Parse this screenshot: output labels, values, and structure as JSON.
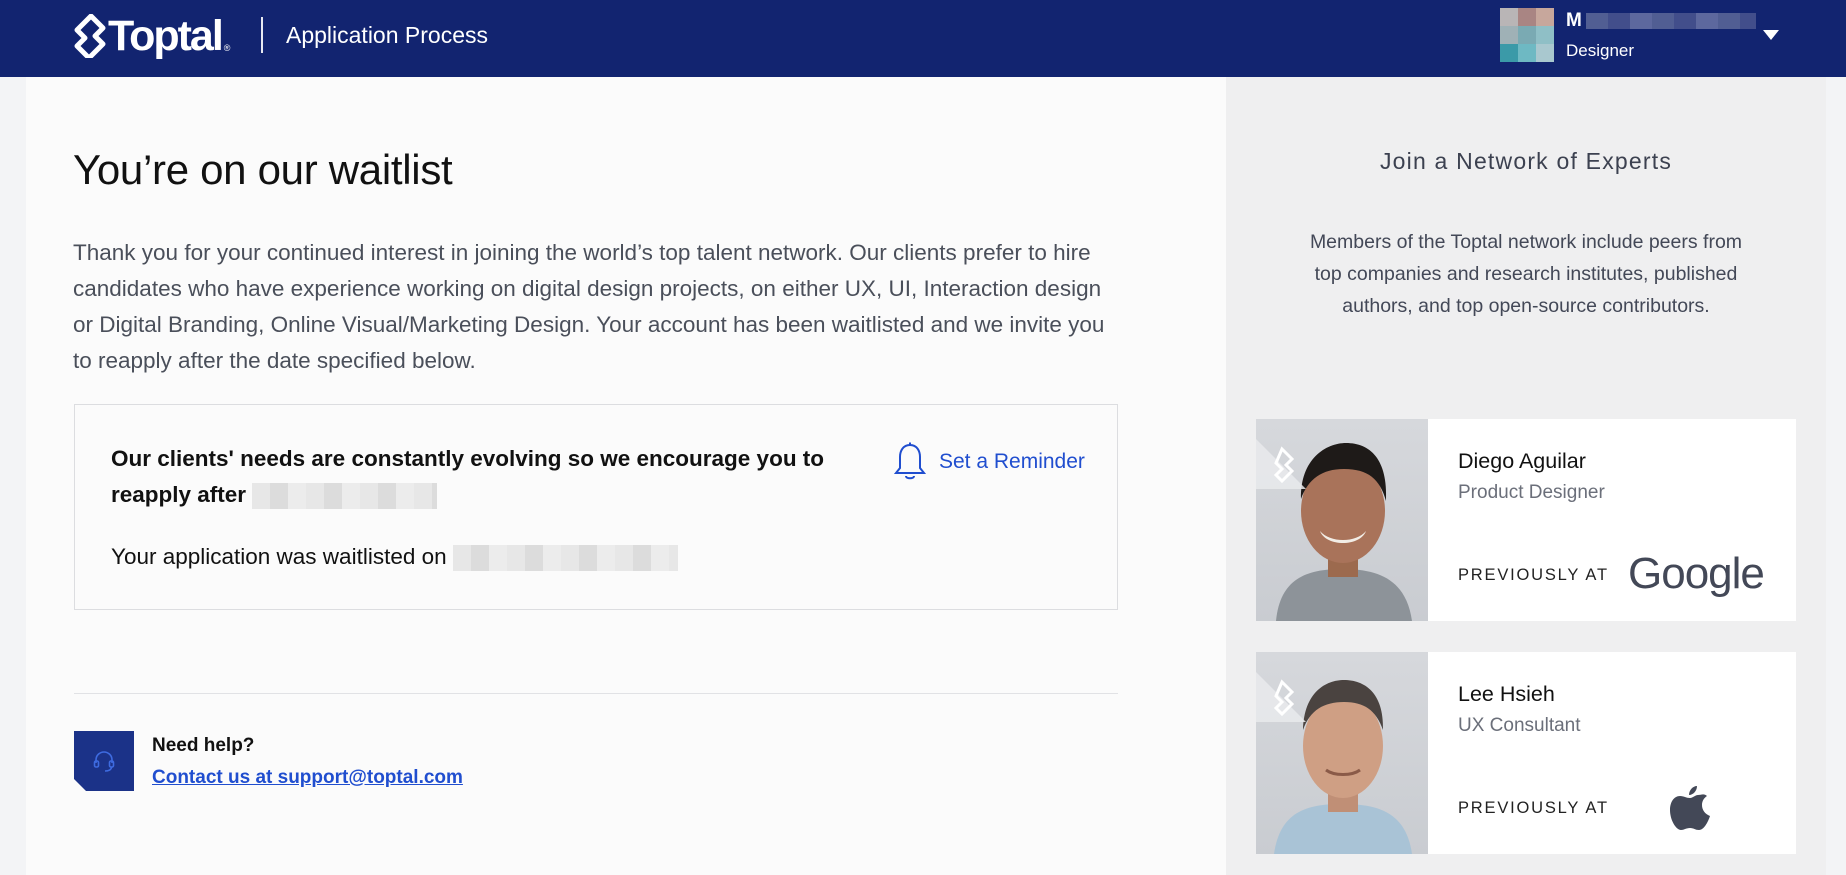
{
  "header": {
    "logo_text": "Toptal",
    "logo_reg": "®",
    "app_title": "Application Process",
    "user": {
      "name_initial": "M",
      "role": "Designer"
    }
  },
  "main": {
    "title": "You’re on our waitlist",
    "intro": "Thank you for your continued interest in joining the world’s top talent network. Our clients prefer to hire candidates who have experience working on digital design projects, on either UX, UI, Interaction design or Digital Branding, Online Visual/Marketing Design. Your account has been waitlisted and we invite you to reapply after the date specified below.",
    "card": {
      "message": "Our clients' needs are constantly evolving so we encourage you to reapply after",
      "waitlisted_label": "Your application was waitlisted on",
      "reminder_label": "Set a Reminder"
    },
    "help": {
      "title": "Need help?",
      "link": "Contact us at support@toptal.com"
    }
  },
  "sidebar": {
    "title": "Join a Network of Experts",
    "description": "Members of the Toptal network include peers from top companies and research institutes, published authors, and top open-source contributors.",
    "experts": [
      {
        "name": "Diego Aguilar",
        "role": "Product Designer",
        "previously": "PREVIOUSLY AT",
        "company": "Google",
        "company_icon": "google-logo"
      },
      {
        "name": "Lee Hsieh",
        "role": "UX Consultant",
        "previously": "PREVIOUSLY AT",
        "company_icon": "apple-logo"
      }
    ]
  },
  "colors": {
    "header_bg": "#122470",
    "accent_link": "#204ecf",
    "help_icon_bg": "#1b3288"
  }
}
